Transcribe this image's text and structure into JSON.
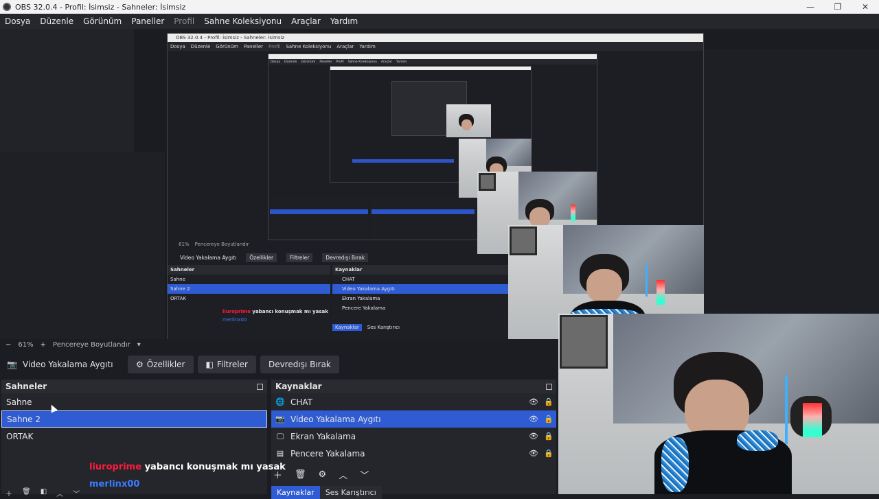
{
  "window": {
    "title": "OBS 32.0.4 - Profil: İsimsiz - Sahneler: İsimsiz",
    "minimize": "—",
    "maximize": "❐",
    "close": "✕"
  },
  "menu": {
    "items": [
      "Dosya",
      "Düzenle",
      "Görünüm",
      "Paneller",
      "Profil",
      "Sahne Koleksiyonu",
      "Araçlar",
      "Yardım"
    ]
  },
  "nested": {
    "title": "OBS 32.0.4 - Profil: İsimsiz - Sahneler: İsimsiz",
    "menu": [
      "Dosya",
      "Düzenle",
      "Görünüm",
      "Paneller",
      "Profil",
      "Sahne Koleksiyonu",
      "Araçlar",
      "Yardım"
    ],
    "zoom": "61%",
    "fit": "Pencereye Boyutlandır",
    "source_name": "Video Yakalama Aygıtı",
    "props": "Özellikler",
    "filters": "Filtreler",
    "deactivate": "Devredışı Bırak",
    "scenes_title": "Sahneler",
    "sources_title": "Kaynaklar",
    "scenes": [
      "Sahne",
      "Sahne 2",
      "ORTAK"
    ],
    "sources": [
      "CHAT",
      "Video Yakalama Aygıtı",
      "Ekran Yakalama",
      "Pencere Yakalama"
    ],
    "chat_user": "liuroprime",
    "chat_msg": "yabancı konuşmak mı yasak",
    "chat_user2": "merlinx00",
    "tab1": "Kaynaklar",
    "tab2": "Ses Karıştırıcı"
  },
  "zoombar": {
    "minus": "−",
    "zoom": "61%",
    "plus": "+",
    "fit": "Pencereye Boyutlandır",
    "caret": "▾"
  },
  "toolbar": {
    "source_name": "Video Yakalama Aygıtı",
    "properties": "Özellikler",
    "filters": "Filtreler",
    "deactivate": "Devredışı Bırak"
  },
  "scenes": {
    "title": "Sahneler",
    "items": [
      "Sahne",
      "Sahne 2",
      "ORTAK"
    ],
    "selected": 1
  },
  "sources": {
    "title": "Kaynaklar",
    "items": [
      {
        "label": "CHAT",
        "icon": "globe-icon"
      },
      {
        "label": "Video Yakalama Aygıtı",
        "icon": "camera-icon"
      },
      {
        "label": "Ekran Yakalama",
        "icon": "monitor-icon"
      },
      {
        "label": "Pencere Yakalama",
        "icon": "window-icon"
      }
    ],
    "selected": 1
  },
  "chat": {
    "user": "liuroprime",
    "message": "yabancı konuşmak mı yasak",
    "user2": "merlinx00"
  },
  "tabs": {
    "sources": "Kaynaklar",
    "mixer": "Ses Karıştırıcı"
  },
  "colors": {
    "accent": "#2f5bd3",
    "chat_user": "#ff1a3a",
    "chat_user2": "#3b7cff"
  }
}
